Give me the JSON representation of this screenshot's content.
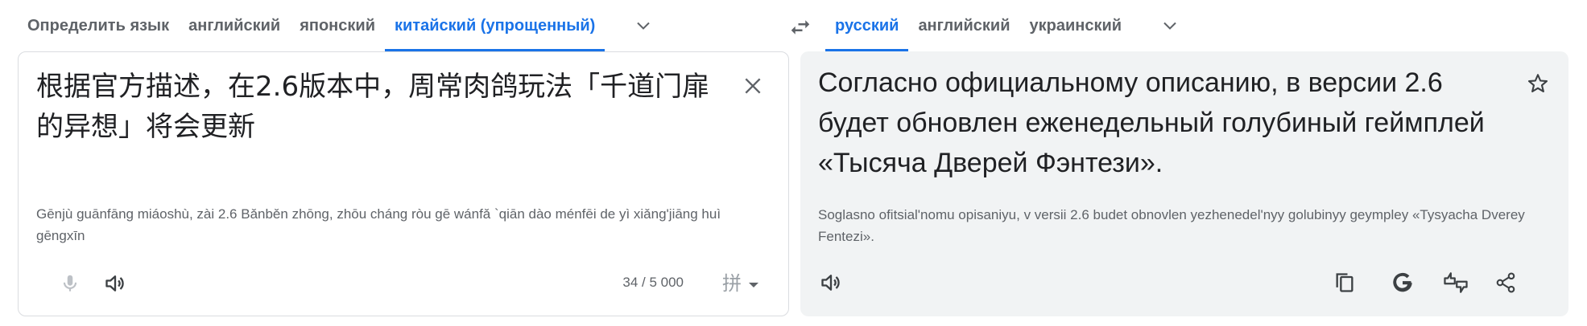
{
  "source": {
    "languages": [
      {
        "label": "Определить язык",
        "active": false
      },
      {
        "label": "английский",
        "active": false
      },
      {
        "label": "японский",
        "active": false
      },
      {
        "label": "китайский (упрощенный)",
        "active": true
      }
    ],
    "text": "根据官方描述，在2.6版本中，周常肉鸽玩法「千道门扉的异想」将会更新",
    "transliteration": "Gēnjù guānfāng miáoshù, zài 2.6 Bǎnběn zhōng, zhōu cháng ròu gē wánfǎ `qiān dào ménfēi de yì xiǎng'jiāng huì gēngxīn",
    "char_count": "34 / 5 000",
    "ime_label": "拼"
  },
  "target": {
    "languages": [
      {
        "label": "русский",
        "active": true
      },
      {
        "label": "английский",
        "active": false
      },
      {
        "label": "украинский",
        "active": false
      }
    ],
    "text": "Согласно официальному описанию, в версии 2.6 будет обновлен еженедельный голубиный геймплей «Тысяча Дверей Фэнтези».",
    "transliteration": "Soglasno ofitsial'nomu opisaniyu, v versii 2.6 budet obnovlen yezhenedel'nyy golubinyy geympley «Tysyacha Dverey Fentezi»."
  },
  "colors": {
    "accent": "#1a73e8",
    "icon": "#5f6368",
    "muted": "#9aa0a6",
    "panel_bg": "#f1f3f4"
  },
  "icons": [
    "chevron-down-icon",
    "swap-icon",
    "close-icon",
    "mic-icon",
    "speaker-icon",
    "star-icon",
    "copy-icon",
    "google-g-icon",
    "feedback-icon",
    "share-icon"
  ]
}
